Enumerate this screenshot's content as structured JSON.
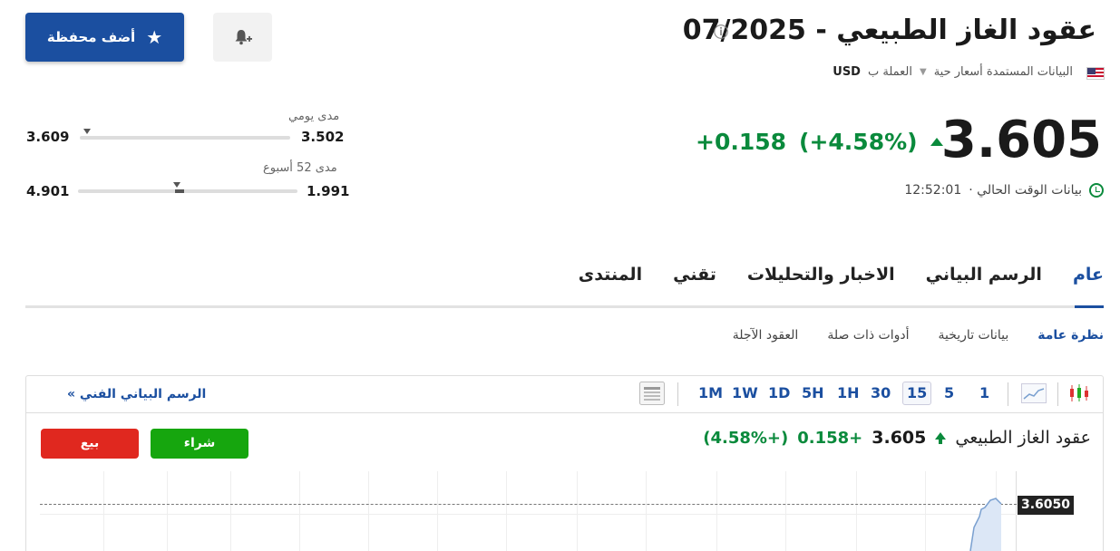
{
  "header": {
    "title": "عقود الغاز الطبيعي - 07/2025",
    "info_icon": "ⓘ",
    "currency_label": "العملة ب",
    "currency": "USD",
    "data_source": "البيانات المستمدة أسعار حية",
    "add_portfolio": "أضف محفظة"
  },
  "quote": {
    "price": "3.605",
    "change": "+0.158",
    "change_pct": "(+4.58%)",
    "time_label": "بيانات الوقت الحالي ·",
    "time": "12:52:01"
  },
  "ranges": {
    "daily": {
      "label": "مدى يومي",
      "low": "3.502",
      "high": "3.609",
      "position": 0.97
    },
    "week52": {
      "label": "مدى 52 أسبوع",
      "low": "1.991",
      "high": "4.901",
      "position": 0.55
    }
  },
  "tabs": [
    {
      "label": "عام",
      "active": true
    },
    {
      "label": "الرسم البياني"
    },
    {
      "label": "الاخبار والتحليلات"
    },
    {
      "label": "تقني"
    },
    {
      "label": "المنتدى"
    }
  ],
  "subtabs": [
    {
      "label": "نظرة عامة",
      "active": true
    },
    {
      "label": "بيانات تاريخية"
    },
    {
      "label": "أدوات ذات صلة"
    },
    {
      "label": "العقود الآجلة"
    }
  ],
  "chart_widget": {
    "timeframes": [
      "1",
      "5",
      "15",
      "30",
      "1H",
      "5H",
      "1D",
      "1W",
      "1M"
    ],
    "selected_timeframe": "15",
    "tech_chart_link": "الرسم البياني الفني",
    "tech_chart_arrow": "»",
    "instrument_name": "عقود الغاز الطبيعي",
    "price": "3.605",
    "change": "+0.158",
    "change_pct": "(+4.58%)",
    "buy": "شراء",
    "sell": "بيع",
    "last_price_tag": "3.6050"
  },
  "colors": {
    "accent": "#1b4fa0",
    "positive": "#0a8a3c",
    "buy": "#16a60e",
    "sell": "#e0281f"
  }
}
